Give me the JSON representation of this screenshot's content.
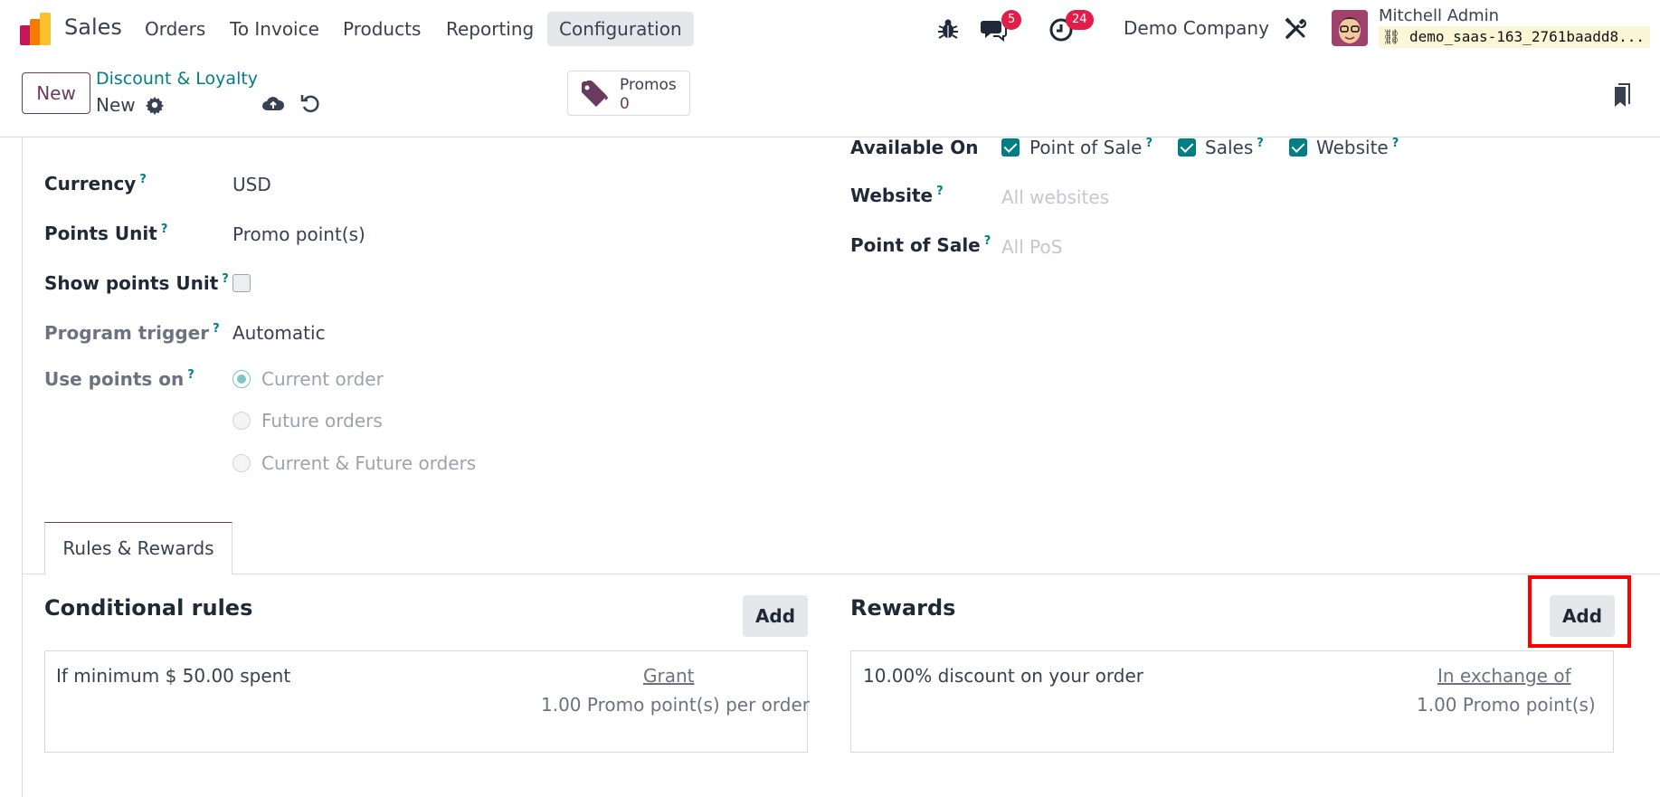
{
  "navbar": {
    "app_name": "Sales",
    "menu": [
      "Orders",
      "To Invoice",
      "Products",
      "Reporting",
      "Configuration"
    ],
    "active_menu": "Configuration",
    "messages_badge": "5",
    "activities_badge": "24",
    "company": "Demo Company",
    "user_name": "Mitchell Admin",
    "database": "demo_saas-163_2761baadd8..."
  },
  "control_panel": {
    "new_button": "New",
    "breadcrumb_parent": "Discount & Loyalty",
    "breadcrumb_current": "New",
    "stat_button": {
      "label": "Promos",
      "value": "0"
    }
  },
  "form": {
    "left": {
      "currency_label": "Currency",
      "currency_value": "USD",
      "points_unit_label": "Points Unit",
      "points_unit_value": "Promo point(s)",
      "show_points_unit_label": "Show points Unit",
      "program_trigger_label": "Program trigger",
      "program_trigger_value": "Automatic",
      "use_points_on_label": "Use points on",
      "use_points_on_options": [
        "Current order",
        "Future orders",
        "Current & Future orders"
      ],
      "use_points_on_selected": "Current order"
    },
    "right": {
      "available_on_label": "Available On",
      "available_on_options": [
        "Point of Sale",
        "Sales",
        "Website"
      ],
      "website_label": "Website",
      "website_placeholder": "All websites",
      "pos_label": "Point of Sale",
      "pos_placeholder": "All PoS"
    },
    "help_mark": "?"
  },
  "tabs": [
    "Rules & Rewards"
  ],
  "rules": {
    "title": "Conditional rules",
    "add_label": "Add",
    "item": {
      "text": "If minimum $ 50.00 spent",
      "link": "Grant",
      "sub": "1.00 Promo point(s) per order"
    }
  },
  "rewards": {
    "title": "Rewards",
    "add_label": "Add",
    "item": {
      "text": "10.00% discount on your order",
      "link": "In exchange of",
      "sub": "1.00 Promo point(s)"
    }
  },
  "colors": {
    "brand": "#6b3b5f",
    "accent": "#017e84",
    "badge": "#e11d48",
    "highlight": "#ff0000"
  }
}
